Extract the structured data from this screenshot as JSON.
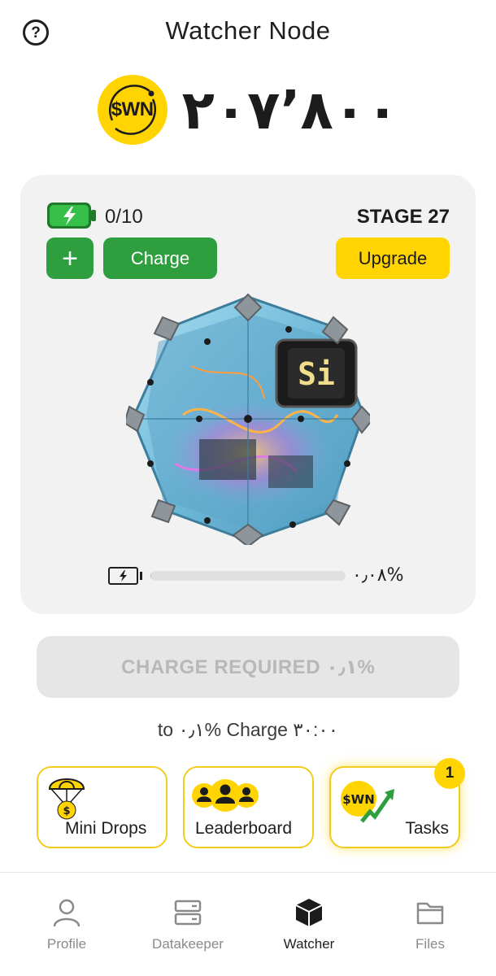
{
  "header": {
    "title": "Watcher Node",
    "help_icon": "question-circle-icon"
  },
  "balance": {
    "coin_label": "$WN",
    "value": "۲۰۷٬۸۰۰"
  },
  "node_card": {
    "charges": "0/10",
    "stage": "STAGE 27",
    "plus_label": "+",
    "charge_label": "Charge",
    "upgrade_label": "Upgrade",
    "progress_percent": "۰٫۰۸%",
    "progress_fraction": 0.0008,
    "art_label": "Si"
  },
  "charge_required_label": "CHARGE REQUIRED ۰٫۱%",
  "timer_text": "to ۰٫۱% Charge ۳۰:۰۰",
  "features": {
    "mini_drops": "Mini Drops",
    "leaderboard": "Leaderboard",
    "tasks": "Tasks",
    "tasks_badge": "1",
    "tasks_coin_label": "$WN"
  },
  "nav": {
    "items": [
      {
        "label": "Profile",
        "icon": "person-icon"
      },
      {
        "label": "Datakeeper",
        "icon": "server-icon"
      },
      {
        "label": "Watcher",
        "icon": "cube-icon"
      },
      {
        "label": "Files",
        "icon": "folder-icon"
      }
    ],
    "active": "Watcher"
  },
  "colors": {
    "accent_yellow": "#ffd400",
    "green": "#2e9e3e",
    "card_bg": "#f2f2f2",
    "disabled_text": "#b8b8b8",
    "nav_inactive": "#8a8a8a"
  }
}
